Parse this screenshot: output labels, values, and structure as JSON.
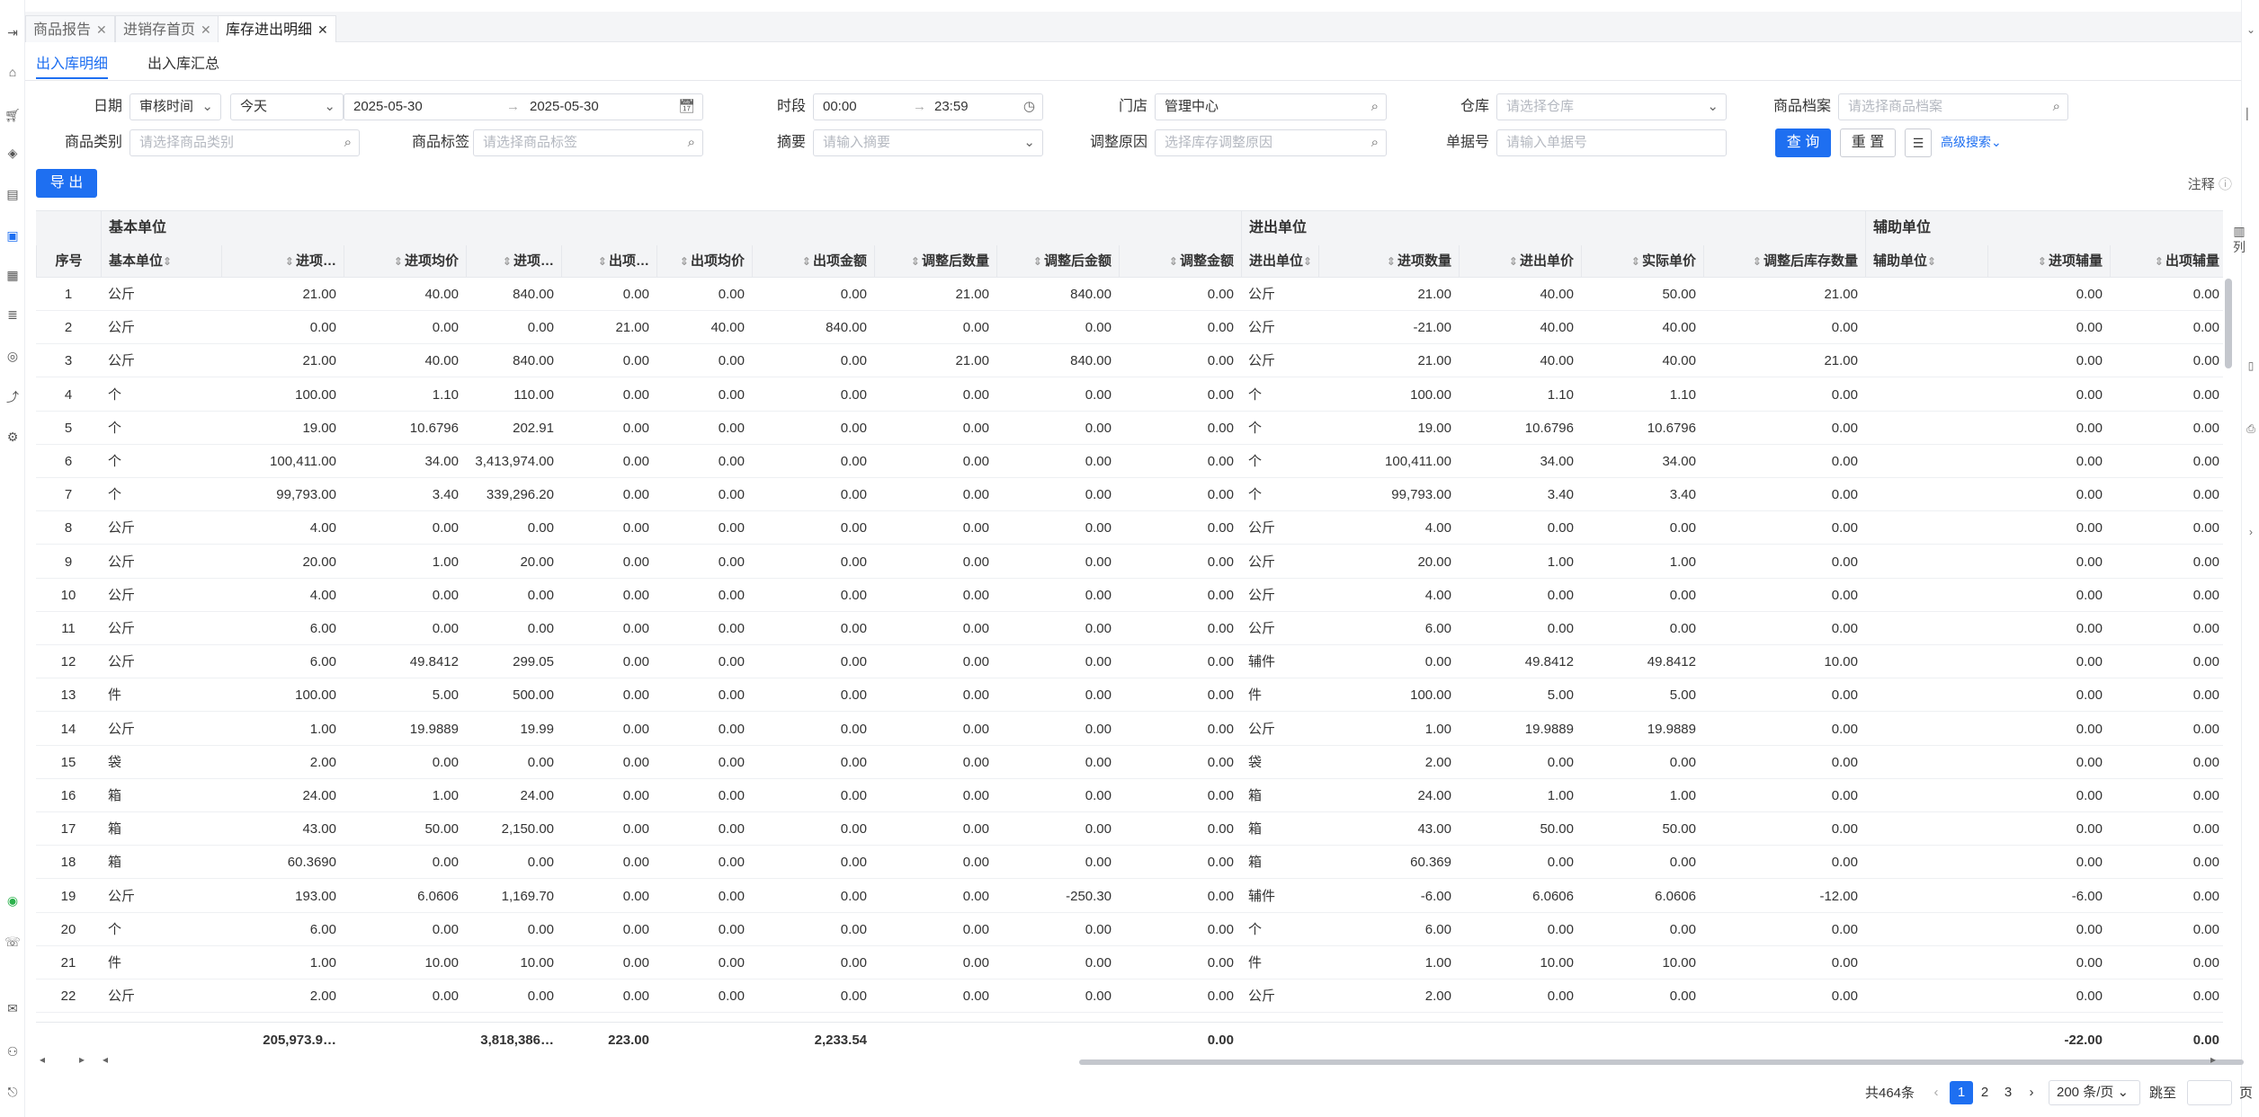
{
  "tabs": [
    {
      "label": "商品报告",
      "active": false
    },
    {
      "label": "进销存首页",
      "active": false
    },
    {
      "label": "库存进出明细",
      "active": true
    }
  ],
  "subtabs": [
    {
      "label": "出入库明细",
      "active": true
    },
    {
      "label": "出入库汇总",
      "active": false
    }
  ],
  "filters": {
    "date_label": "日期",
    "date_type": "审核时间",
    "date_range": "今天",
    "date_start": "2025-05-30",
    "date_end": "2025-05-30",
    "time_label": "时段",
    "time_start": "00:00",
    "time_end": "23:59",
    "store_label": "门店",
    "store_value": "管理中心",
    "warehouse_label": "仓库",
    "warehouse_placeholder": "请选择仓库",
    "product_label": "商品档案",
    "product_placeholder": "请选择商品档案",
    "category_label": "商品类别",
    "category_placeholder": "请选择商品类别",
    "tag_label": "商品标签",
    "tag_placeholder": "请选择商品标签",
    "summary_label": "摘要",
    "summary_placeholder": "请输入摘要",
    "reason_label": "调整原因",
    "reason_placeholder": "选择库存调整原因",
    "docno_label": "单据号",
    "docno_placeholder": "请输入单据号"
  },
  "actions": {
    "query": "查 询",
    "reset": "重 置",
    "advanced": "高级搜索",
    "export": "导 出",
    "note": "注释",
    "columns": "列"
  },
  "groups": [
    "基本单位",
    "进出单位",
    "辅助单位"
  ],
  "columns": [
    "序号",
    "基本单位",
    "进项…",
    "进项均价",
    "进项…",
    "出项…",
    "出项均价",
    "出项金额",
    "调整后数量",
    "调整后金额",
    "调整金额",
    "进出单位",
    "进项数量",
    "进出单价",
    "实际单价",
    "调整后库存数量",
    "辅助单位",
    "进项辅量",
    "出项辅量"
  ],
  "rows": [
    [
      "1",
      "公斤",
      "21.00",
      "40.00",
      "840.00",
      "0.00",
      "0.00",
      "0.00",
      "21.00",
      "840.00",
      "0.00",
      "公斤",
      "21.00",
      "40.00",
      "50.00",
      "21.00",
      "",
      "0.00",
      "0.00"
    ],
    [
      "2",
      "公斤",
      "0.00",
      "0.00",
      "0.00",
      "21.00",
      "40.00",
      "840.00",
      "0.00",
      "0.00",
      "0.00",
      "公斤",
      "-21.00",
      "40.00",
      "40.00",
      "0.00",
      "",
      "0.00",
      "0.00"
    ],
    [
      "3",
      "公斤",
      "21.00",
      "40.00",
      "840.00",
      "0.00",
      "0.00",
      "0.00",
      "21.00",
      "840.00",
      "0.00",
      "公斤",
      "21.00",
      "40.00",
      "40.00",
      "21.00",
      "",
      "0.00",
      "0.00"
    ],
    [
      "4",
      "个",
      "100.00",
      "1.10",
      "110.00",
      "0.00",
      "0.00",
      "0.00",
      "0.00",
      "0.00",
      "0.00",
      "个",
      "100.00",
      "1.10",
      "1.10",
      "0.00",
      "",
      "0.00",
      "0.00"
    ],
    [
      "5",
      "个",
      "19.00",
      "10.6796",
      "202.91",
      "0.00",
      "0.00",
      "0.00",
      "0.00",
      "0.00",
      "0.00",
      "个",
      "19.00",
      "10.6796",
      "10.6796",
      "0.00",
      "",
      "0.00",
      "0.00"
    ],
    [
      "6",
      "个",
      "100,411.00",
      "34.00",
      "3,413,974.00",
      "0.00",
      "0.00",
      "0.00",
      "0.00",
      "0.00",
      "0.00",
      "个",
      "100,411.00",
      "34.00",
      "34.00",
      "0.00",
      "",
      "0.00",
      "0.00"
    ],
    [
      "7",
      "个",
      "99,793.00",
      "3.40",
      "339,296.20",
      "0.00",
      "0.00",
      "0.00",
      "0.00",
      "0.00",
      "0.00",
      "个",
      "99,793.00",
      "3.40",
      "3.40",
      "0.00",
      "",
      "0.00",
      "0.00"
    ],
    [
      "8",
      "公斤",
      "4.00",
      "0.00",
      "0.00",
      "0.00",
      "0.00",
      "0.00",
      "0.00",
      "0.00",
      "0.00",
      "公斤",
      "4.00",
      "0.00",
      "0.00",
      "0.00",
      "",
      "0.00",
      "0.00"
    ],
    [
      "9",
      "公斤",
      "20.00",
      "1.00",
      "20.00",
      "0.00",
      "0.00",
      "0.00",
      "0.00",
      "0.00",
      "0.00",
      "公斤",
      "20.00",
      "1.00",
      "1.00",
      "0.00",
      "",
      "0.00",
      "0.00"
    ],
    [
      "10",
      "公斤",
      "4.00",
      "0.00",
      "0.00",
      "0.00",
      "0.00",
      "0.00",
      "0.00",
      "0.00",
      "0.00",
      "公斤",
      "4.00",
      "0.00",
      "0.00",
      "0.00",
      "",
      "0.00",
      "0.00"
    ],
    [
      "11",
      "公斤",
      "6.00",
      "0.00",
      "0.00",
      "0.00",
      "0.00",
      "0.00",
      "0.00",
      "0.00",
      "0.00",
      "公斤",
      "6.00",
      "0.00",
      "0.00",
      "0.00",
      "",
      "0.00",
      "0.00"
    ],
    [
      "12",
      "公斤",
      "6.00",
      "49.8412",
      "299.05",
      "0.00",
      "0.00",
      "0.00",
      "0.00",
      "0.00",
      "0.00",
      "辅件",
      "0.00",
      "49.8412",
      "49.8412",
      "10.00",
      "",
      "0.00",
      "0.00"
    ],
    [
      "13",
      "件",
      "100.00",
      "5.00",
      "500.00",
      "0.00",
      "0.00",
      "0.00",
      "0.00",
      "0.00",
      "0.00",
      "件",
      "100.00",
      "5.00",
      "5.00",
      "0.00",
      "",
      "0.00",
      "0.00"
    ],
    [
      "14",
      "公斤",
      "1.00",
      "19.9889",
      "19.99",
      "0.00",
      "0.00",
      "0.00",
      "0.00",
      "0.00",
      "0.00",
      "公斤",
      "1.00",
      "19.9889",
      "19.9889",
      "0.00",
      "",
      "0.00",
      "0.00"
    ],
    [
      "15",
      "袋",
      "2.00",
      "0.00",
      "0.00",
      "0.00",
      "0.00",
      "0.00",
      "0.00",
      "0.00",
      "0.00",
      "袋",
      "2.00",
      "0.00",
      "0.00",
      "0.00",
      "",
      "0.00",
      "0.00"
    ],
    [
      "16",
      "箱",
      "24.00",
      "1.00",
      "24.00",
      "0.00",
      "0.00",
      "0.00",
      "0.00",
      "0.00",
      "0.00",
      "箱",
      "24.00",
      "1.00",
      "1.00",
      "0.00",
      "",
      "0.00",
      "0.00"
    ],
    [
      "17",
      "箱",
      "43.00",
      "50.00",
      "2,150.00",
      "0.00",
      "0.00",
      "0.00",
      "0.00",
      "0.00",
      "0.00",
      "箱",
      "43.00",
      "50.00",
      "50.00",
      "0.00",
      "",
      "0.00",
      "0.00"
    ],
    [
      "18",
      "箱",
      "60.3690",
      "0.00",
      "0.00",
      "0.00",
      "0.00",
      "0.00",
      "0.00",
      "0.00",
      "0.00",
      "箱",
      "60.369",
      "0.00",
      "0.00",
      "0.00",
      "",
      "0.00",
      "0.00"
    ],
    [
      "19",
      "公斤",
      "193.00",
      "6.0606",
      "1,169.70",
      "0.00",
      "0.00",
      "0.00",
      "0.00",
      "-250.30",
      "0.00",
      "辅件",
      "-6.00",
      "6.0606",
      "6.0606",
      "-12.00",
      "",
      "-6.00",
      "0.00"
    ],
    [
      "20",
      "个",
      "6.00",
      "0.00",
      "0.00",
      "0.00",
      "0.00",
      "0.00",
      "0.00",
      "0.00",
      "0.00",
      "个",
      "6.00",
      "0.00",
      "0.00",
      "0.00",
      "",
      "0.00",
      "0.00"
    ],
    [
      "21",
      "件",
      "1.00",
      "10.00",
      "10.00",
      "0.00",
      "0.00",
      "0.00",
      "0.00",
      "0.00",
      "0.00",
      "件",
      "1.00",
      "10.00",
      "10.00",
      "0.00",
      "",
      "0.00",
      "0.00"
    ],
    [
      "22",
      "公斤",
      "2.00",
      "0.00",
      "0.00",
      "0.00",
      "0.00",
      "0.00",
      "0.00",
      "0.00",
      "0.00",
      "公斤",
      "2.00",
      "0.00",
      "0.00",
      "0.00",
      "",
      "0.00",
      "0.00"
    ]
  ],
  "totals": [
    "",
    "",
    "205,973.9…",
    "",
    "3,818,386…",
    "223.00",
    "",
    "2,233.54",
    "",
    "",
    "0.00",
    "",
    "",
    "",
    "",
    "",
    "",
    "-22.00",
    "0.00"
  ],
  "pagination": {
    "total": "共464条",
    "pages": [
      "1",
      "2",
      "3"
    ],
    "current": "1",
    "page_size": "200 条/页",
    "goto": "跳至",
    "page_suffix": "页"
  },
  "colors": {
    "accent": "#1e6ff1"
  }
}
